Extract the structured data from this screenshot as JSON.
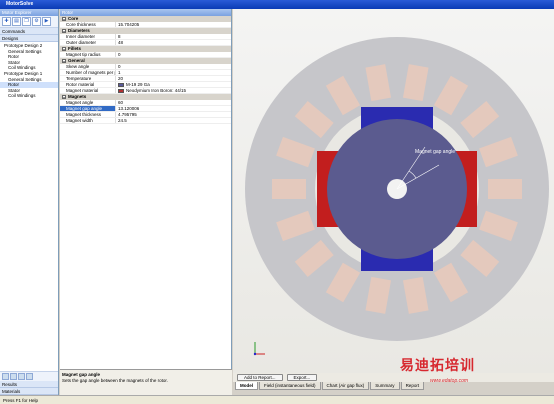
{
  "app": {
    "title": "MotorSolve"
  },
  "explorer": {
    "header": "Motor Explorer",
    "commands_label": "Commands",
    "designs_label": "Designs",
    "tree": [
      {
        "label": "Prototype Design 2",
        "indent": 1,
        "selected": false
      },
      {
        "label": "General Settings",
        "indent": 2,
        "selected": false
      },
      {
        "label": "Rotor",
        "indent": 2,
        "selected": false
      },
      {
        "label": "Stator",
        "indent": 2,
        "selected": false
      },
      {
        "label": "Coil Windings",
        "indent": 2,
        "selected": false
      },
      {
        "label": "Prototype Design 1",
        "indent": 1,
        "selected": false
      },
      {
        "label": "General Settings",
        "indent": 2,
        "selected": false
      },
      {
        "label": "Rotor",
        "indent": 2,
        "selected": true
      },
      {
        "label": "Stator",
        "indent": 2,
        "selected": false
      },
      {
        "label": "Coil Windings",
        "indent": 2,
        "selected": false
      }
    ],
    "results_label": "Results",
    "materials_label": "Materials"
  },
  "props": {
    "header": "Rotor",
    "sections": [
      {
        "title": "Core",
        "rows": [
          {
            "name": "Core thickness",
            "value": "15.704205"
          }
        ]
      },
      {
        "title": "Diameters",
        "rows": [
          {
            "name": "Inner diameter",
            "value": "8"
          },
          {
            "name": "Outer diameter",
            "value": "48"
          }
        ]
      },
      {
        "title": "Fillets",
        "rows": [
          {
            "name": "Magnet tip radius",
            "value": "0"
          }
        ]
      },
      {
        "title": "General",
        "rows": [
          {
            "name": "Skew angle",
            "value": "0"
          },
          {
            "name": "Number of magnets per pole",
            "value": "1"
          },
          {
            "name": "Temperature",
            "value": "20"
          },
          {
            "name": "Rotor material",
            "value": "M-19 29 Ga",
            "swatch": "#5a5a9a"
          },
          {
            "name": "Magnet material",
            "value": "Neodymium Iron Boron: 44/15",
            "swatch": "#b23030"
          }
        ]
      },
      {
        "title": "Magnets",
        "rows": [
          {
            "name": "Magnet angle",
            "value": "60"
          },
          {
            "name": "Magnet gap angle",
            "value": "13.120006",
            "selected": true
          },
          {
            "name": "Magnet thickness",
            "value": "4.795795"
          },
          {
            "name": "Magnet width",
            "value": "24.5"
          }
        ]
      }
    ]
  },
  "description": {
    "title": "Magnet gap angle",
    "text": "Sets the gap angle between the magnets of the rotor."
  },
  "viewport": {
    "annotation": "Magnet gap angle",
    "colors": {
      "stator": "#c6c6ca",
      "teeth": "#e4c9bd",
      "rotor": "#5b5b8f",
      "magnet_blue": "#2a2bb0",
      "magnet_red": "#c21e1e"
    }
  },
  "view_buttons": {
    "add_to_report": "Add to Report...",
    "export": "Export..."
  },
  "tabs": [
    {
      "label": "Model",
      "active": true
    },
    {
      "label": "Field (instantaneous field)",
      "active": false
    },
    {
      "label": "Chart (Air gap flux)",
      "active": false
    },
    {
      "label": "Summary",
      "active": false
    },
    {
      "label": "Report",
      "active": false
    }
  ],
  "status": {
    "text": "Press F1 for Help"
  },
  "watermark": {
    "cn": "易迪拓培训",
    "url": "www.edatop.com"
  }
}
